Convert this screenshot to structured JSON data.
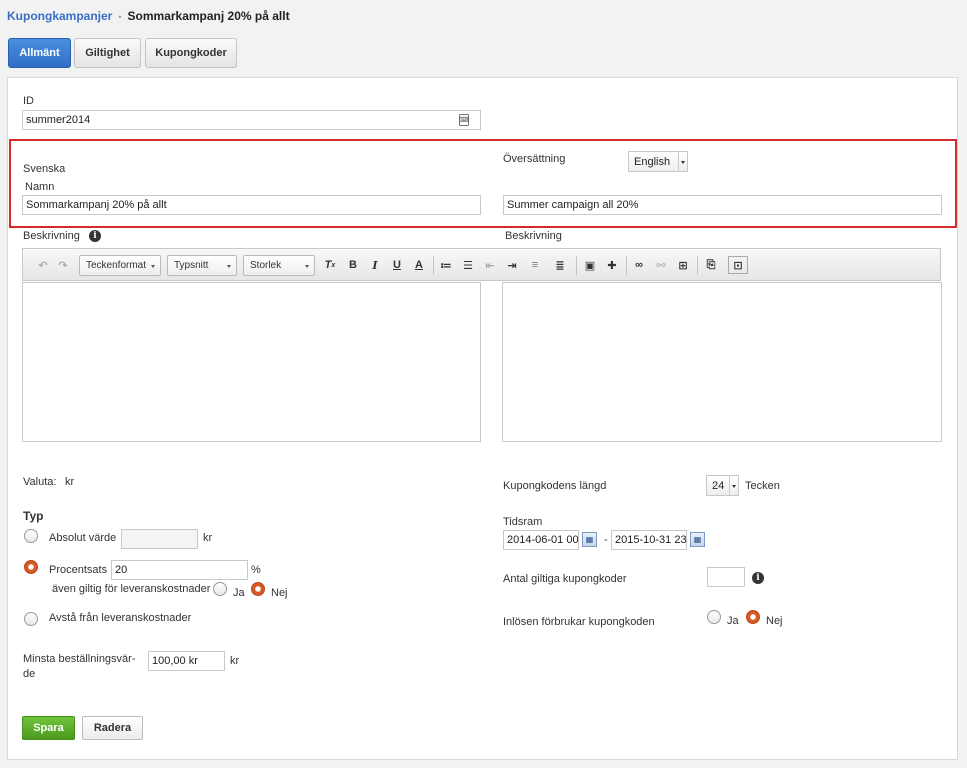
{
  "breadcrumb": {
    "root": "Kupongkampanjer",
    "separator": "•",
    "current": "Sommarkampanj 20% på allt"
  },
  "tabs": [
    {
      "label": "Allmänt",
      "active": true
    },
    {
      "label": "Giltighet",
      "active": false
    },
    {
      "label": "Kupongkoder",
      "active": false
    }
  ],
  "id_field": {
    "label": "ID",
    "value": "summer2014"
  },
  "language": {
    "primary_label": "Svenska",
    "translation_label": "Översättning",
    "translation_selected": "English",
    "name_label": "Namn",
    "name_value": "Sommarkampanj 20% på allt",
    "name_translation": "Summer campaign all 20%"
  },
  "description": {
    "label_left": "Beskrivning",
    "label_right": "Beskrivning"
  },
  "editor_toolbar": {
    "format": "Teckenformat",
    "font": "Typsnitt",
    "size": "Storlek",
    "bold": "B",
    "italic": "I",
    "underline": "U",
    "fontcolor": "A"
  },
  "currency": {
    "label": "Valuta:",
    "value": "kr"
  },
  "type": {
    "heading": "Typ",
    "absolute_label": "Absolut värde",
    "absolute_unit": "kr",
    "percent_label": "Procentsats",
    "percent_value": "20",
    "percent_unit": "%",
    "shipping_label": "även giltig för leveranskostnader",
    "yes": "Ja",
    "no": "Nej",
    "free_shipping_label": "Avstå från leveranskostnader"
  },
  "min_order": {
    "label_line1": "Minsta beställningsvär-",
    "label_line2": "de",
    "value": "100,00 kr",
    "unit": "kr"
  },
  "code_length": {
    "label": "Kupongkodens längd",
    "value": "24",
    "unit": "Tecken"
  },
  "timeframe": {
    "label": "Tidsram",
    "from": "2014-06-01 00",
    "dash": "-",
    "to": "2015-10-31 23"
  },
  "valid_codes": {
    "label": "Antal giltiga kupongkoder",
    "value": ""
  },
  "redeem": {
    "label": "Inlösen förbrukar kupongkoden",
    "yes": "Ja",
    "no": "Nej"
  },
  "buttons": {
    "save": "Spara",
    "delete": "Radera"
  },
  "colors": {
    "accent": "#3a6fc4",
    "highlight_border": "#d42a2a",
    "save_green": "#5aaa28",
    "radio_on": "#d65a26"
  }
}
